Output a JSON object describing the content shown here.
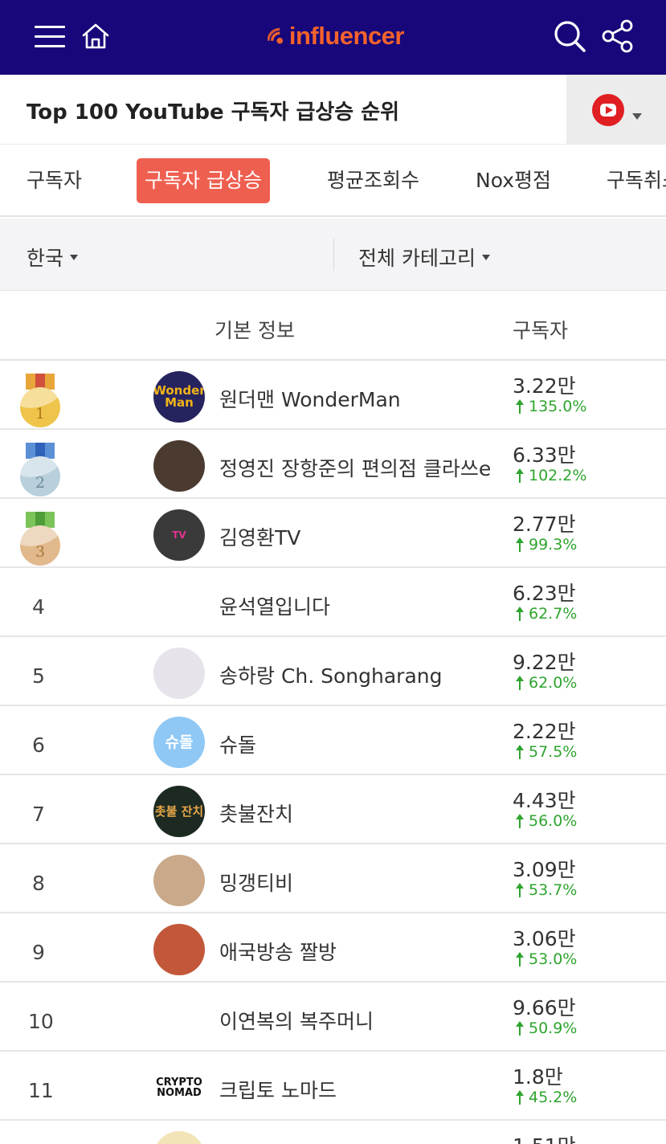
{
  "header": {
    "logo_text": "influencer",
    "icons": [
      "menu-icon",
      "home-icon",
      "search-icon",
      "share-icon"
    ],
    "background_color": "#17077a",
    "logo_color": "#f4622c"
  },
  "title_bar": {
    "title": "Top 100 YouTube 구독자 급상승 순위",
    "platform_icon": "youtube-icon"
  },
  "tabs": [
    {
      "label": "구독자",
      "active": false
    },
    {
      "label": "구독자 급상승",
      "active": true
    },
    {
      "label": "평균조회수",
      "active": false
    },
    {
      "label": "Nox평점",
      "active": false
    },
    {
      "label": "구독취소",
      "active": false
    }
  ],
  "tab_active_color": "#ef5f50",
  "filters": {
    "country": "한국",
    "category": "전체 카테고리"
  },
  "table": {
    "col_info": "기본 정보",
    "col_subscribers": "구독자",
    "rows": [
      {
        "rank": "1",
        "medal": "gold",
        "avatar_text": "Wonder Man",
        "name": "원더맨 WonderMan",
        "subs": "3.22만",
        "growth": "135.0%"
      },
      {
        "rank": "2",
        "medal": "silver",
        "avatar_text": "",
        "name": "정영진 장항준의 편의점 클라쓰e",
        "subs": "6.33만",
        "growth": "102.2%"
      },
      {
        "rank": "3",
        "medal": "bronze",
        "avatar_text": "TV",
        "name": "김영환TV",
        "subs": "2.77만",
        "growth": "99.3%"
      },
      {
        "rank": "4",
        "medal": "",
        "avatar_text": "",
        "name": "윤석열입니다",
        "subs": "6.23만",
        "growth": "62.7%"
      },
      {
        "rank": "5",
        "medal": "",
        "avatar_text": "",
        "name": "송하랑 Ch. Songharang",
        "subs": "9.22만",
        "growth": "62.0%"
      },
      {
        "rank": "6",
        "medal": "",
        "avatar_text": "슈돌",
        "name": "슈돌",
        "subs": "2.22만",
        "growth": "57.5%"
      },
      {
        "rank": "7",
        "medal": "",
        "avatar_text": "촛불 잔치",
        "name": "촛불잔치",
        "subs": "4.43만",
        "growth": "56.0%"
      },
      {
        "rank": "8",
        "medal": "",
        "avatar_text": "",
        "name": "밍갱티비",
        "subs": "3.09만",
        "growth": "53.7%"
      },
      {
        "rank": "9",
        "medal": "",
        "avatar_text": "",
        "name": "애국방송 짤방",
        "subs": "3.06만",
        "growth": "53.0%"
      },
      {
        "rank": "10",
        "medal": "",
        "avatar_text": "",
        "name": "이연복의 복주머니",
        "subs": "9.66만",
        "growth": "50.9%"
      },
      {
        "rank": "11",
        "medal": "",
        "avatar_text": "CRYPTO NOMAD",
        "name": "크립토 노마드",
        "subs": "1.8만",
        "growth": "45.2%"
      },
      {
        "rank": "12",
        "medal": "",
        "avatar_text": "",
        "name": "",
        "subs": "1.51만",
        "growth": ""
      }
    ]
  },
  "growth_color": "#2ea52e"
}
